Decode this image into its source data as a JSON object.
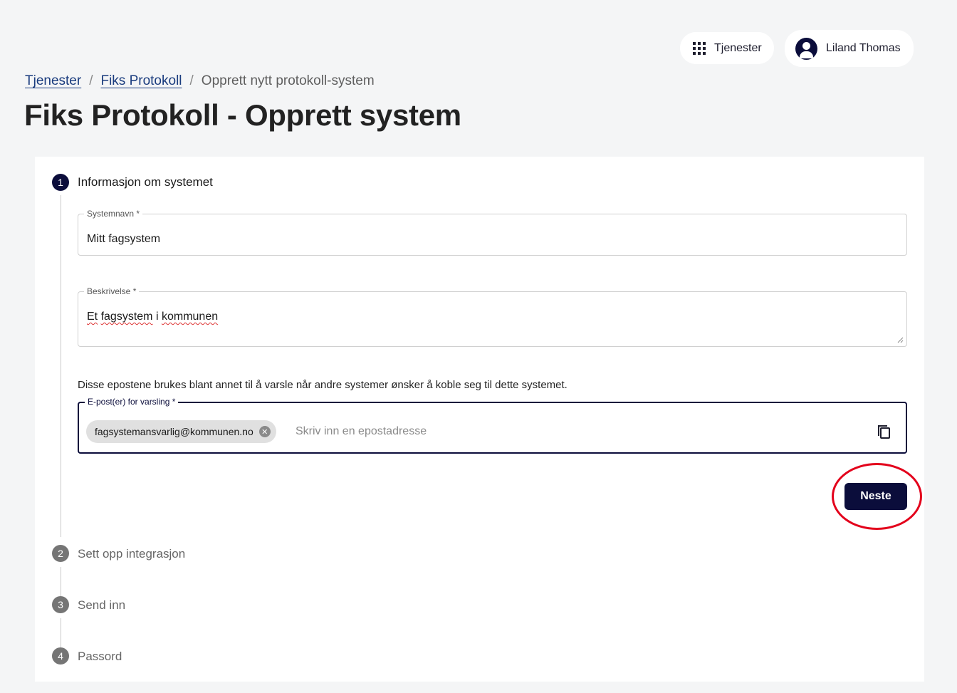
{
  "header": {
    "services_label": "Tjenester",
    "user_name": "Liland Thomas"
  },
  "breadcrumb": {
    "items": [
      "Tjenester",
      "Fiks Protokoll"
    ],
    "separator": "/",
    "current": "Opprett nytt protokoll-system"
  },
  "page_title": "Fiks Protokoll - Opprett system",
  "stepper": {
    "steps": [
      {
        "number": "1",
        "label": "Informasjon om systemet",
        "state": "active"
      },
      {
        "number": "2",
        "label": "Sett opp integrasjon",
        "state": "inactive"
      },
      {
        "number": "3",
        "label": "Send inn",
        "state": "inactive"
      },
      {
        "number": "4",
        "label": "Passord",
        "state": "inactive"
      }
    ]
  },
  "form": {
    "system_name": {
      "label": "Systemnavn *",
      "value": "Mitt fagsystem"
    },
    "description": {
      "label": "Beskrivelse *",
      "words": [
        "Et",
        "fagsystem",
        "i",
        "kommunen"
      ]
    },
    "email_hint": "Disse epostene brukes blant annet til å varsle når andre systemer ønsker å koble seg til dette systemet.",
    "emails": {
      "label": "E-post(er) for varsling *",
      "chips": [
        "fagsystemansvarlig@kommunen.no"
      ],
      "placeholder": "Skriv inn en epostadresse"
    },
    "next_label": "Neste"
  },
  "colors": {
    "primary": "#0b0d3b",
    "page_background": "#f4f5f6",
    "link": "#1a3c7e",
    "highlight_ring": "#e3001b"
  }
}
